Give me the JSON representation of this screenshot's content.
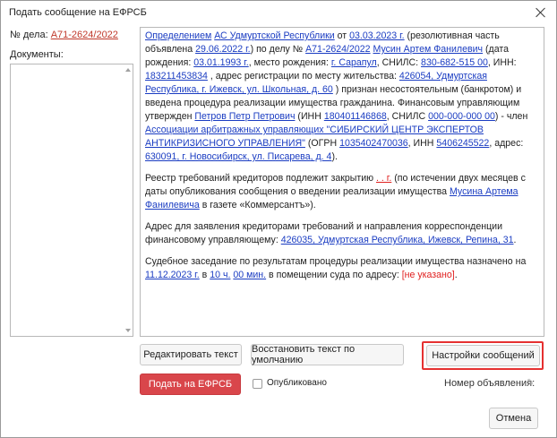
{
  "window": {
    "title": "Подать сообщение на ЕФРСБ"
  },
  "left": {
    "case_label": "№ дела:",
    "case_number": "А71-2624/2022",
    "documents_label": "Документы:"
  },
  "text": {
    "p1": {
      "s1": "Определением",
      "s2": " ",
      "s3": "АС Удмуртской Республики",
      "s4": " от ",
      "s5": "03.03.2023 г.",
      "s6": " (резолютивная часть объявлена ",
      "s7": "29.06.2022 г.",
      "s8": ") по делу № ",
      "s9": "А71-2624/2022",
      "s10": " ",
      "s11": "Мусин Артем Фанилевич",
      "s12": " (дата рождения: ",
      "s13": "03.01.1993 г.",
      "s14": ", место рождения: ",
      "s15": "г. Сарапул",
      "s16": ", СНИЛС: ",
      "s17": "830-682-515 00",
      "s18": ", ИНН: ",
      "s19": "183211453834",
      "s20": " , адрес регистрации по месту жительства: ",
      "s21": "426054, Удмуртская Республика, г. Ижевск, ул. Школьная, д. 60",
      "s22": " ) признан несостоятельным (банкротом) и введена процедура реализации имущества гражданина. Финансовым управляющим утвержден ",
      "s23": "Петров Петр Петрович",
      "s24": " (ИНН ",
      "s25": "180401146868",
      "s26": ", СНИЛС ",
      "s27": "000-000-000 00",
      "s28": ") - член ",
      "s29": "Ассоциации арбитражных управляющих \"СИБИРСКИЙ ЦЕНТР ЭКСПЕРТОВ АНТИКРИЗИСНОГО УПРАВЛЕНИЯ\"",
      "s30": " (ОГРН ",
      "s31": "1035402470036",
      "s32": ", ИНН ",
      "s33": "5406245522",
      "s34": ", адрес: ",
      "s35": "630091, г. Новосибирск, ул. Писарева, д. 4",
      "s36": ")."
    },
    "p2": {
      "s1": "Реестр требований кредиторов подлежит закрытию ",
      "s2": "  .  .   г.",
      "s3": " (по истечении двух месяцев с даты опубликования сообщения о введении реализации имущества ",
      "s4": "Мусина Артема Фанилевича",
      "s5": " в газете «Коммерсантъ»)."
    },
    "p3": {
      "s1": "Адрес для заявления кредиторами требований и направления корреспонденции финансовому управляющему: ",
      "s2": "426035, Удмуртская Республика, Ижевск, Репина, 31",
      "s3": "."
    },
    "p4": {
      "s1": "Судебное заседание по результатам процедуры реализации имущества назначено на ",
      "s2": "11.12.2023 г.",
      "s3": " в ",
      "s4": "10 ч.",
      "s5": " ",
      "s6": "00 мин.",
      "s7": " в помещении суда по адресу: ",
      "s8": "[не указано]",
      "s9": "."
    }
  },
  "buttons": {
    "edit_text": "Редактировать текст",
    "restore_text": "Восстановить текст по умолчанию",
    "message_settings": "Настройки сообщений",
    "submit": "Подать на ЕФРСБ",
    "cancel": "Отмена"
  },
  "published_label": "Опубликовано",
  "ad_number_label": "Номер объявления:",
  "colors": {
    "link": "#1a3cc2",
    "red": "#e0201f",
    "submit_bg": "#d9464b",
    "highlight": "#e53030"
  }
}
